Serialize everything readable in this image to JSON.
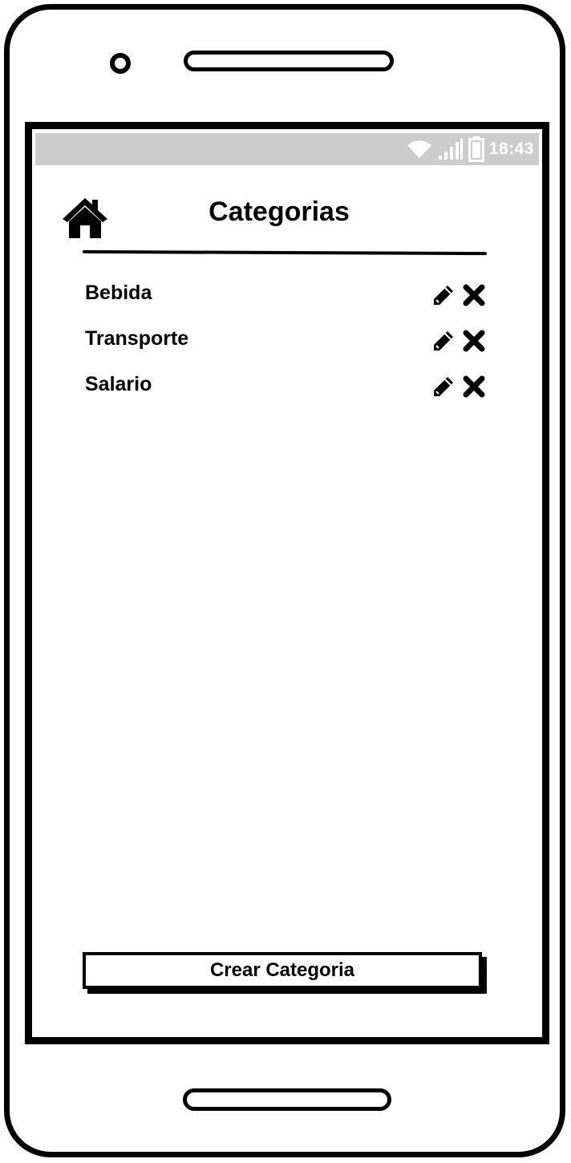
{
  "status_bar": {
    "time": "18:43",
    "icons": [
      "wifi-icon",
      "signal-icon",
      "battery-icon"
    ]
  },
  "header": {
    "title": "Categorias",
    "home_icon": "home-icon"
  },
  "categories": [
    {
      "name": "Bebida"
    },
    {
      "name": "Transporte"
    },
    {
      "name": "Salario"
    }
  ],
  "actions": {
    "edit_icon": "pencil-icon",
    "delete_icon": "close-icon"
  },
  "footer": {
    "create_label": "Crear Categoria"
  }
}
